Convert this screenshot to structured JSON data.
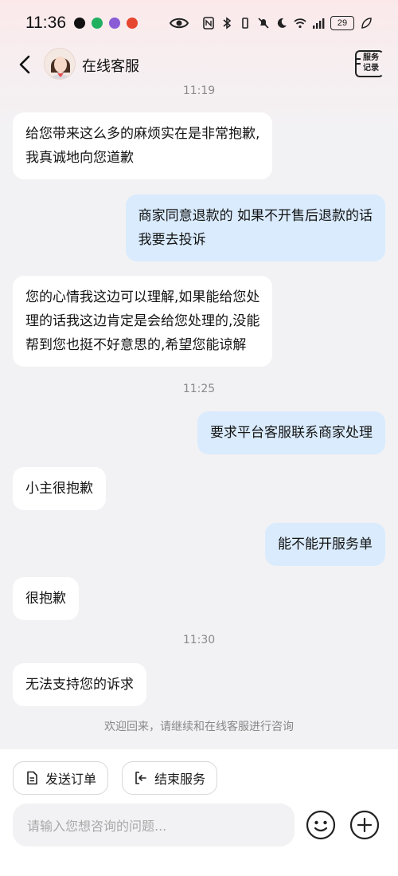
{
  "status_bar": {
    "time": "11:36",
    "battery": "29",
    "app_icons": [
      {
        "name": "qq-icon",
        "color": "#111111"
      },
      {
        "name": "wechat-icon",
        "color": "#20b060"
      },
      {
        "name": "app-icon",
        "color": "#8a5cd6"
      },
      {
        "name": "taobao-icon",
        "color": "#e6452f"
      }
    ]
  },
  "header": {
    "title": "在线客服",
    "record_line1": "服务",
    "record_line2": "记录"
  },
  "messages": [
    {
      "type": "time",
      "text": "11:19"
    },
    {
      "type": "left",
      "lines": [
        "给您带来这么多的麻烦实在是非常抱歉,",
        "我真诚地向您道歉"
      ]
    },
    {
      "type": "right",
      "lines": [
        "商家同意退款的 如果不开售后退款的话",
        "我要去投诉"
      ]
    },
    {
      "type": "left",
      "lines": [
        "您的心情我这边可以理解,如果能给您处",
        "理的话我这边肯定是会给您处理的,没能",
        "帮到您也挺不好意思的,希望您能谅解"
      ]
    },
    {
      "type": "time",
      "text": "11:25"
    },
    {
      "type": "right",
      "lines": [
        "要求平台客服联系商家处理"
      ]
    },
    {
      "type": "left",
      "lines": [
        "小主很抱歉"
      ]
    },
    {
      "type": "right",
      "lines": [
        "能不能开服务单"
      ]
    },
    {
      "type": "left",
      "lines": [
        "很抱歉"
      ]
    },
    {
      "type": "time",
      "text": "11:30"
    },
    {
      "type": "left",
      "lines": [
        "无法支持您的诉求"
      ]
    }
  ],
  "welcome_text": "欢迎回来，请继续和在线客服进行咨询",
  "actions": {
    "send_order": "发送订单",
    "end_service": "结束服务"
  },
  "input": {
    "placeholder": "请输入您想咨询的问题..."
  }
}
